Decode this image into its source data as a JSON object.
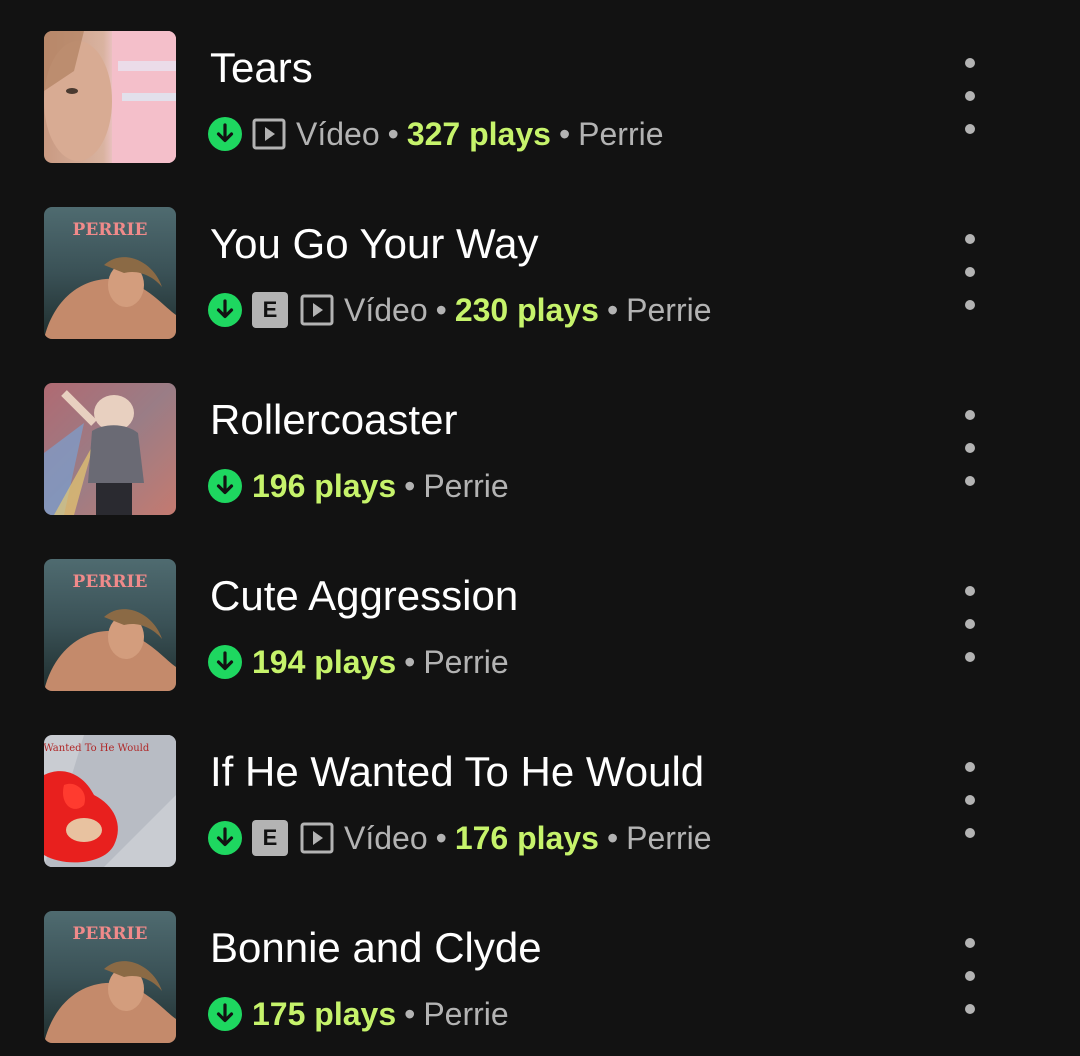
{
  "tracks": [
    {
      "title": "Tears",
      "explicit": false,
      "video_label": "Vídeo",
      "plays": "327 plays",
      "artist": "Perrie",
      "art": "tears-cover"
    },
    {
      "title": "You Go Your Way",
      "explicit": true,
      "video_label": "Vídeo",
      "plays": "230 plays",
      "artist": "Perrie",
      "art": "perrie-album-cover",
      "art_text": "PERRIE"
    },
    {
      "title": "Rollercoaster",
      "explicit": false,
      "video_label": "",
      "plays": "196 plays",
      "artist": "Perrie",
      "art": "rollercoaster-cover"
    },
    {
      "title": "Cute Aggression",
      "explicit": false,
      "video_label": "",
      "plays": "194 plays",
      "artist": "Perrie",
      "art": "perrie-album-cover",
      "art_text": "PERRIE"
    },
    {
      "title": "If He Wanted To He Would",
      "explicit": true,
      "video_label": "Vídeo",
      "plays": "176 plays",
      "artist": "Perrie",
      "art": "if-he-wanted-cover",
      "art_text": "If He Wanted To He Would"
    },
    {
      "title": "Bonnie and Clyde",
      "explicit": false,
      "video_label": "",
      "plays": "175 plays",
      "artist": "Perrie",
      "art": "perrie-album-cover",
      "art_text": "PERRIE"
    }
  ],
  "separator": "•",
  "explicit_label": "E",
  "icons": {
    "download": "download-icon",
    "video": "video-icon",
    "more": "more-options-icon"
  },
  "colors": {
    "background": "#121212",
    "accent_green": "#1ed760",
    "plays_highlight": "#c6f36b",
    "secondary_text": "#b3b3b3"
  }
}
